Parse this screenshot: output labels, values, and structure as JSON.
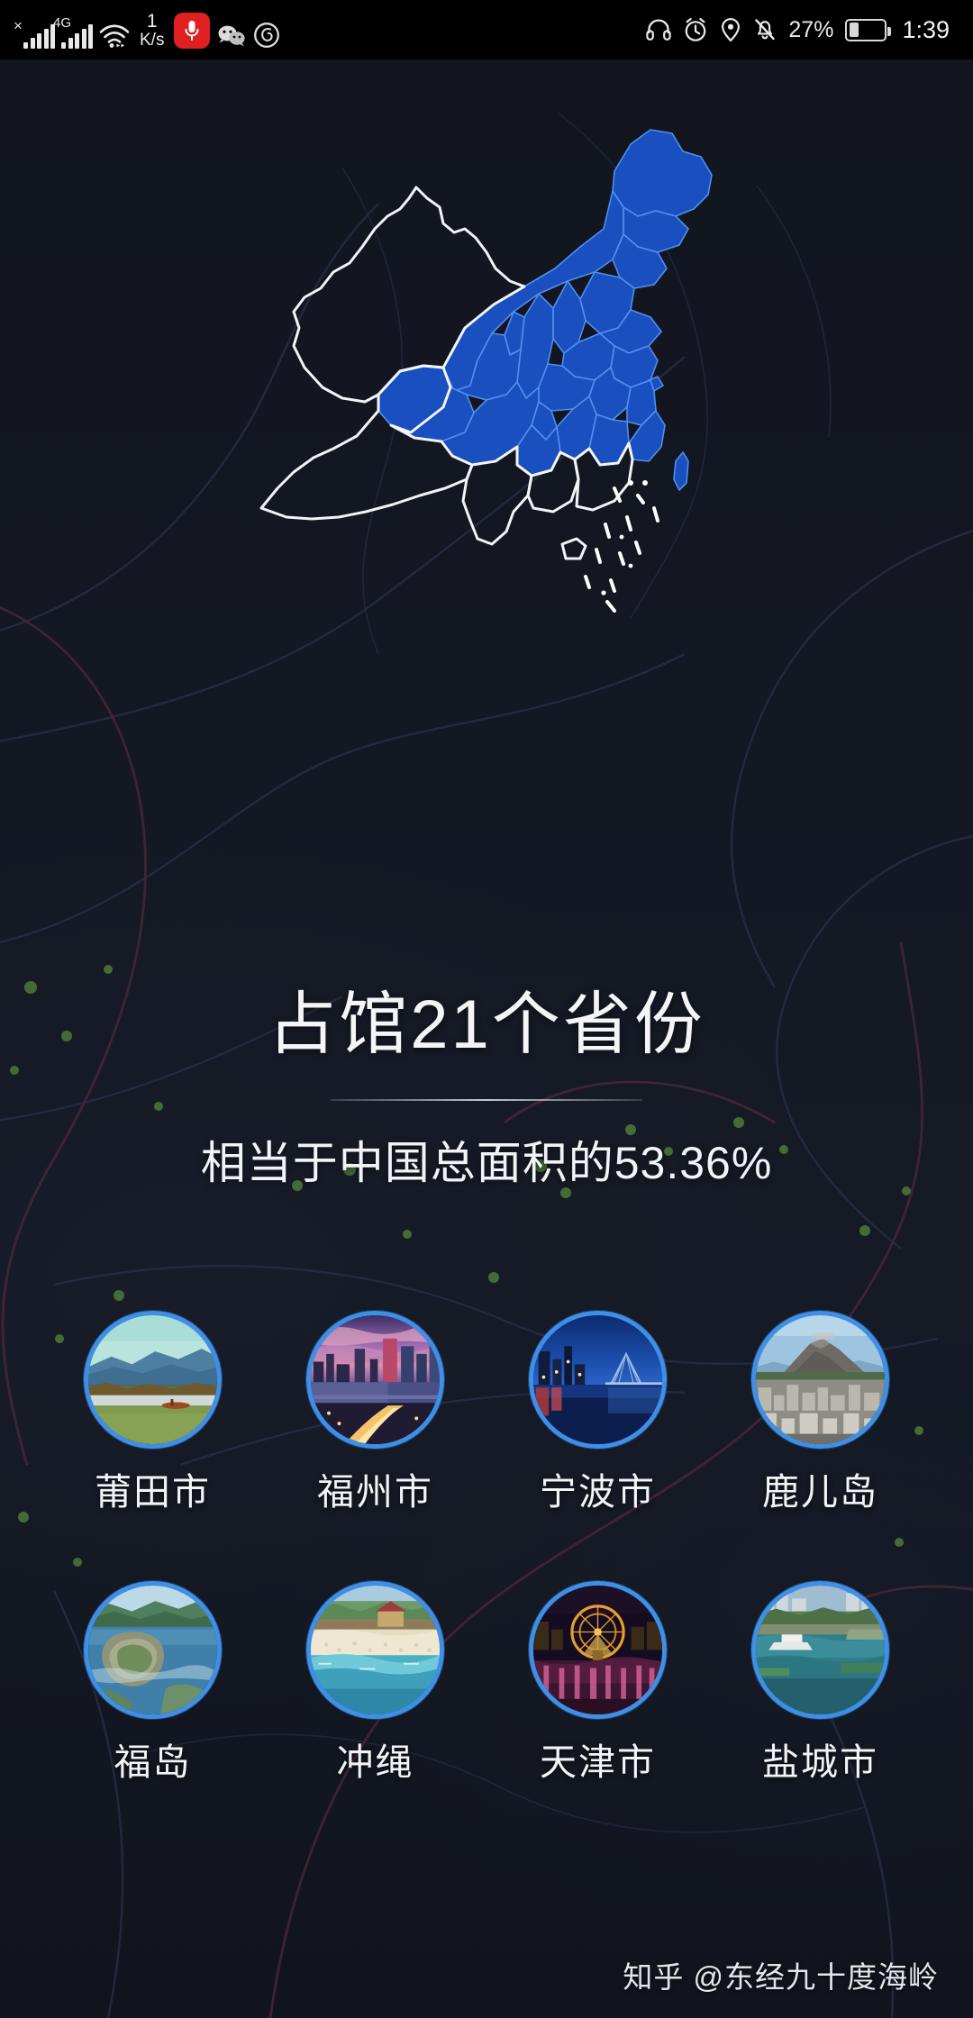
{
  "status_bar": {
    "carrier_x_label": "×",
    "network_label": "4G",
    "net_speed_value": "1",
    "net_speed_unit": "K/s",
    "battery_percent": "27%",
    "battery_level": 27,
    "time": "1:39",
    "icons": [
      "signal-bars-icon",
      "network-4g-icon",
      "wifi-icon",
      "network-speed-icon",
      "voice-recorder-icon",
      "wechat-icon",
      "netease-music-icon",
      "headphones-icon",
      "alarm-clock-icon",
      "location-icon",
      "mute-bell-icon",
      "battery-icon"
    ]
  },
  "map": {
    "name": "china-provinces-map",
    "filled_color": "#1a4fc0",
    "border_color": "#4f90ee",
    "unfilled_border_color": "#f2f4f7",
    "filled_province_count": 21
  },
  "headline": {
    "title": "占馆21个省份",
    "subtitle": "相当于中国总面积的53.36%"
  },
  "cities": [
    {
      "name": "莆田市",
      "thumb": "wetland-lake-scenery"
    },
    {
      "name": "福州市",
      "thumb": "purple-dusk-cityscape"
    },
    {
      "name": "宁波市",
      "thumb": "blue-night-bridge"
    },
    {
      "name": "鹿儿岛",
      "thumb": "volcano-city-view"
    },
    {
      "name": "福岛",
      "thumb": "coastal-cliff-bay"
    },
    {
      "name": "冲绳",
      "thumb": "white-sand-beach"
    },
    {
      "name": "天津市",
      "thumb": "ferris-wheel-night"
    },
    {
      "name": "盐城市",
      "thumb": "riverside-waterfront"
    }
  ],
  "watermark": {
    "text": "知乎 @东经九十度海岭"
  },
  "theme": {
    "background": "#12151e",
    "accent_blue": "#3d8fe8",
    "map_blue": "#1a4fc0",
    "text_primary": "#f2f4f7"
  }
}
